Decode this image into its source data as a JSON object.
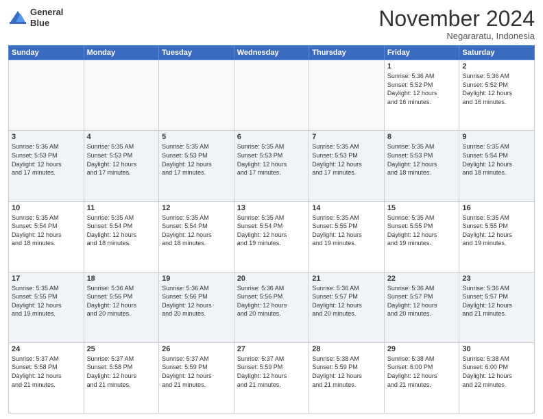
{
  "header": {
    "logo_line1": "General",
    "logo_line2": "Blue",
    "month": "November 2024",
    "location": "Negararatu, Indonesia"
  },
  "weekdays": [
    "Sunday",
    "Monday",
    "Tuesday",
    "Wednesday",
    "Thursday",
    "Friday",
    "Saturday"
  ],
  "weeks": [
    [
      {
        "day": "",
        "info": ""
      },
      {
        "day": "",
        "info": ""
      },
      {
        "day": "",
        "info": ""
      },
      {
        "day": "",
        "info": ""
      },
      {
        "day": "",
        "info": ""
      },
      {
        "day": "1",
        "info": "Sunrise: 5:36 AM\nSunset: 5:52 PM\nDaylight: 12 hours\nand 16 minutes."
      },
      {
        "day": "2",
        "info": "Sunrise: 5:36 AM\nSunset: 5:52 PM\nDaylight: 12 hours\nand 16 minutes."
      }
    ],
    [
      {
        "day": "3",
        "info": "Sunrise: 5:36 AM\nSunset: 5:53 PM\nDaylight: 12 hours\nand 17 minutes."
      },
      {
        "day": "4",
        "info": "Sunrise: 5:35 AM\nSunset: 5:53 PM\nDaylight: 12 hours\nand 17 minutes."
      },
      {
        "day": "5",
        "info": "Sunrise: 5:35 AM\nSunset: 5:53 PM\nDaylight: 12 hours\nand 17 minutes."
      },
      {
        "day": "6",
        "info": "Sunrise: 5:35 AM\nSunset: 5:53 PM\nDaylight: 12 hours\nand 17 minutes."
      },
      {
        "day": "7",
        "info": "Sunrise: 5:35 AM\nSunset: 5:53 PM\nDaylight: 12 hours\nand 17 minutes."
      },
      {
        "day": "8",
        "info": "Sunrise: 5:35 AM\nSunset: 5:53 PM\nDaylight: 12 hours\nand 18 minutes."
      },
      {
        "day": "9",
        "info": "Sunrise: 5:35 AM\nSunset: 5:54 PM\nDaylight: 12 hours\nand 18 minutes."
      }
    ],
    [
      {
        "day": "10",
        "info": "Sunrise: 5:35 AM\nSunset: 5:54 PM\nDaylight: 12 hours\nand 18 minutes."
      },
      {
        "day": "11",
        "info": "Sunrise: 5:35 AM\nSunset: 5:54 PM\nDaylight: 12 hours\nand 18 minutes."
      },
      {
        "day": "12",
        "info": "Sunrise: 5:35 AM\nSunset: 5:54 PM\nDaylight: 12 hours\nand 18 minutes."
      },
      {
        "day": "13",
        "info": "Sunrise: 5:35 AM\nSunset: 5:54 PM\nDaylight: 12 hours\nand 19 minutes."
      },
      {
        "day": "14",
        "info": "Sunrise: 5:35 AM\nSunset: 5:55 PM\nDaylight: 12 hours\nand 19 minutes."
      },
      {
        "day": "15",
        "info": "Sunrise: 5:35 AM\nSunset: 5:55 PM\nDaylight: 12 hours\nand 19 minutes."
      },
      {
        "day": "16",
        "info": "Sunrise: 5:35 AM\nSunset: 5:55 PM\nDaylight: 12 hours\nand 19 minutes."
      }
    ],
    [
      {
        "day": "17",
        "info": "Sunrise: 5:35 AM\nSunset: 5:55 PM\nDaylight: 12 hours\nand 19 minutes."
      },
      {
        "day": "18",
        "info": "Sunrise: 5:36 AM\nSunset: 5:56 PM\nDaylight: 12 hours\nand 20 minutes."
      },
      {
        "day": "19",
        "info": "Sunrise: 5:36 AM\nSunset: 5:56 PM\nDaylight: 12 hours\nand 20 minutes."
      },
      {
        "day": "20",
        "info": "Sunrise: 5:36 AM\nSunset: 5:56 PM\nDaylight: 12 hours\nand 20 minutes."
      },
      {
        "day": "21",
        "info": "Sunrise: 5:36 AM\nSunset: 5:57 PM\nDaylight: 12 hours\nand 20 minutes."
      },
      {
        "day": "22",
        "info": "Sunrise: 5:36 AM\nSunset: 5:57 PM\nDaylight: 12 hours\nand 20 minutes."
      },
      {
        "day": "23",
        "info": "Sunrise: 5:36 AM\nSunset: 5:57 PM\nDaylight: 12 hours\nand 21 minutes."
      }
    ],
    [
      {
        "day": "24",
        "info": "Sunrise: 5:37 AM\nSunset: 5:58 PM\nDaylight: 12 hours\nand 21 minutes."
      },
      {
        "day": "25",
        "info": "Sunrise: 5:37 AM\nSunset: 5:58 PM\nDaylight: 12 hours\nand 21 minutes."
      },
      {
        "day": "26",
        "info": "Sunrise: 5:37 AM\nSunset: 5:59 PM\nDaylight: 12 hours\nand 21 minutes."
      },
      {
        "day": "27",
        "info": "Sunrise: 5:37 AM\nSunset: 5:59 PM\nDaylight: 12 hours\nand 21 minutes."
      },
      {
        "day": "28",
        "info": "Sunrise: 5:38 AM\nSunset: 5:59 PM\nDaylight: 12 hours\nand 21 minutes."
      },
      {
        "day": "29",
        "info": "Sunrise: 5:38 AM\nSunset: 6:00 PM\nDaylight: 12 hours\nand 21 minutes."
      },
      {
        "day": "30",
        "info": "Sunrise: 5:38 AM\nSunset: 6:00 PM\nDaylight: 12 hours\nand 22 minutes."
      }
    ]
  ]
}
